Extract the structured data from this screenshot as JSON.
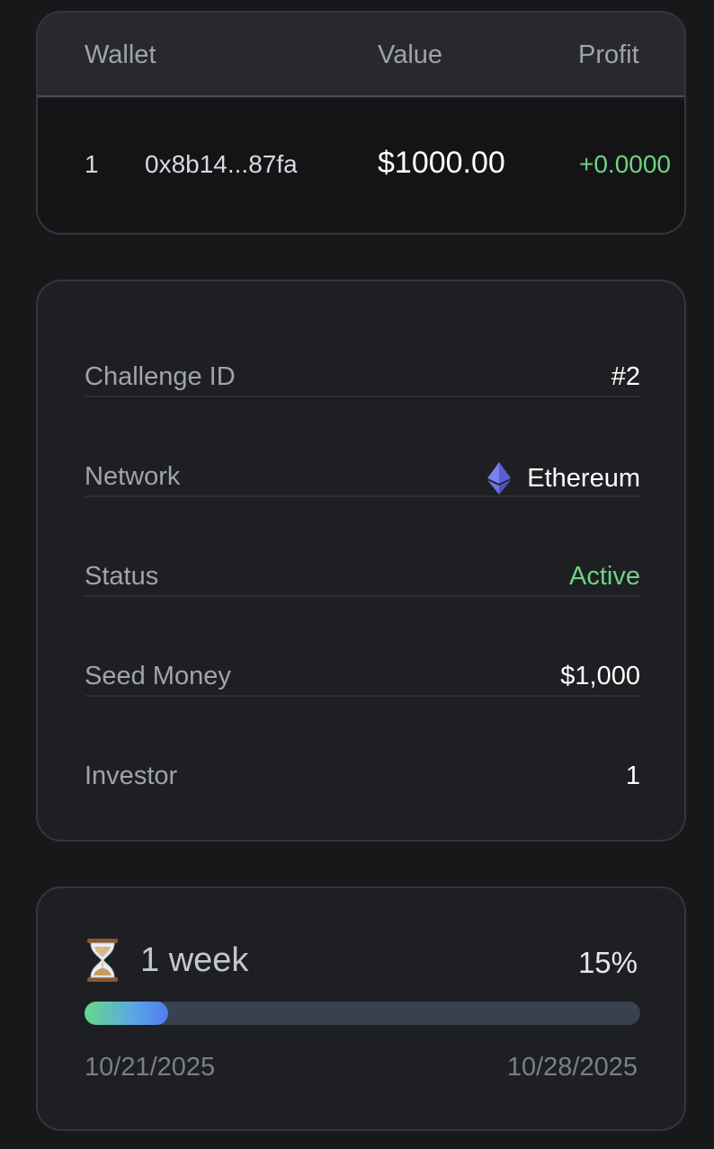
{
  "wallet_table": {
    "headers": {
      "wallet": "Wallet",
      "value": "Value",
      "profit": "Profit"
    },
    "rows": [
      {
        "rank": "1",
        "address": "0x8b14...87fa",
        "value": "$1000.00",
        "profit": "+0.0000"
      }
    ]
  },
  "details": {
    "challenge_id": {
      "label": "Challenge ID",
      "value": "#2"
    },
    "network": {
      "label": "Network",
      "value": "Ethereum",
      "icon": "ethereum-icon"
    },
    "status": {
      "label": "Status",
      "value": "Active",
      "color": "#6fd283"
    },
    "seed_money": {
      "label": "Seed Money",
      "value": "$1,000"
    },
    "investor": {
      "label": "Investor",
      "value": "1"
    }
  },
  "timeline": {
    "icon": "hourglass-icon",
    "duration": "1 week",
    "progress_label": "15%",
    "progress": 0.15,
    "start_date": "10/21/2025",
    "end_date": "10/28/2025"
  }
}
